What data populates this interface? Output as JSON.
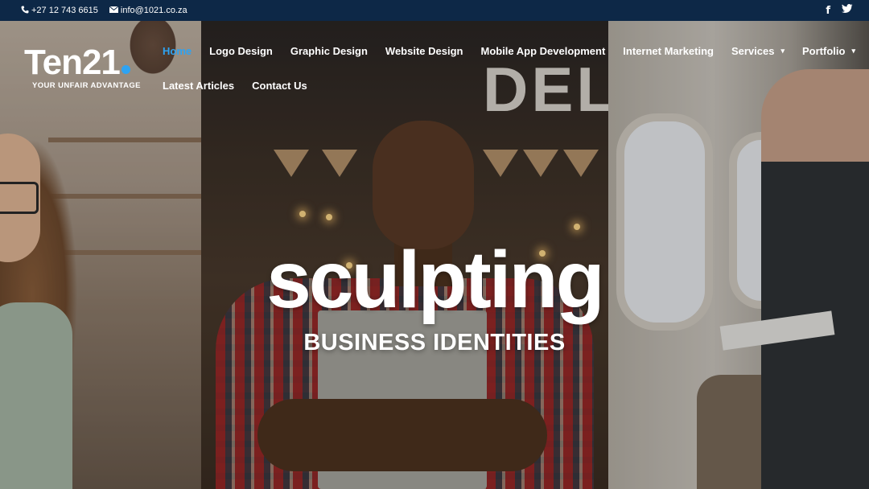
{
  "topbar": {
    "phone": "+27 12 743 6615",
    "email": "info@1021.co.za",
    "phone_icon": "phone-icon",
    "email_icon": "envelope-icon",
    "social": [
      {
        "name": "facebook-icon",
        "glyph": "f"
      },
      {
        "name": "twitter-icon",
        "glyph": "🐦"
      }
    ]
  },
  "logo": {
    "wordmark": "Ten21",
    "tagline": "YOUR UNFAIR ADVANTAGE",
    "dot_color": "#2ea3f2"
  },
  "nav": {
    "row1": [
      {
        "label": "Home",
        "active": true
      },
      {
        "label": "Logo Design"
      },
      {
        "label": "Graphic Design"
      },
      {
        "label": "Website Design"
      },
      {
        "label": "Mobile App Development"
      },
      {
        "label": "Internet Marketing"
      },
      {
        "label": "Services",
        "dropdown": true
      },
      {
        "label": "Portfolio",
        "dropdown": true
      }
    ],
    "row2": [
      {
        "label": "Latest Articles"
      },
      {
        "label": "Contact Us"
      }
    ],
    "caret_glyph": "▾"
  },
  "hero": {
    "headline": "sculpting",
    "subline": "BUSINESS IDENTITIES",
    "sign_text": "DEL"
  },
  "colors": {
    "topbar_bg": "#0d2847",
    "accent": "#2ea3f2",
    "text": "#ffffff"
  }
}
